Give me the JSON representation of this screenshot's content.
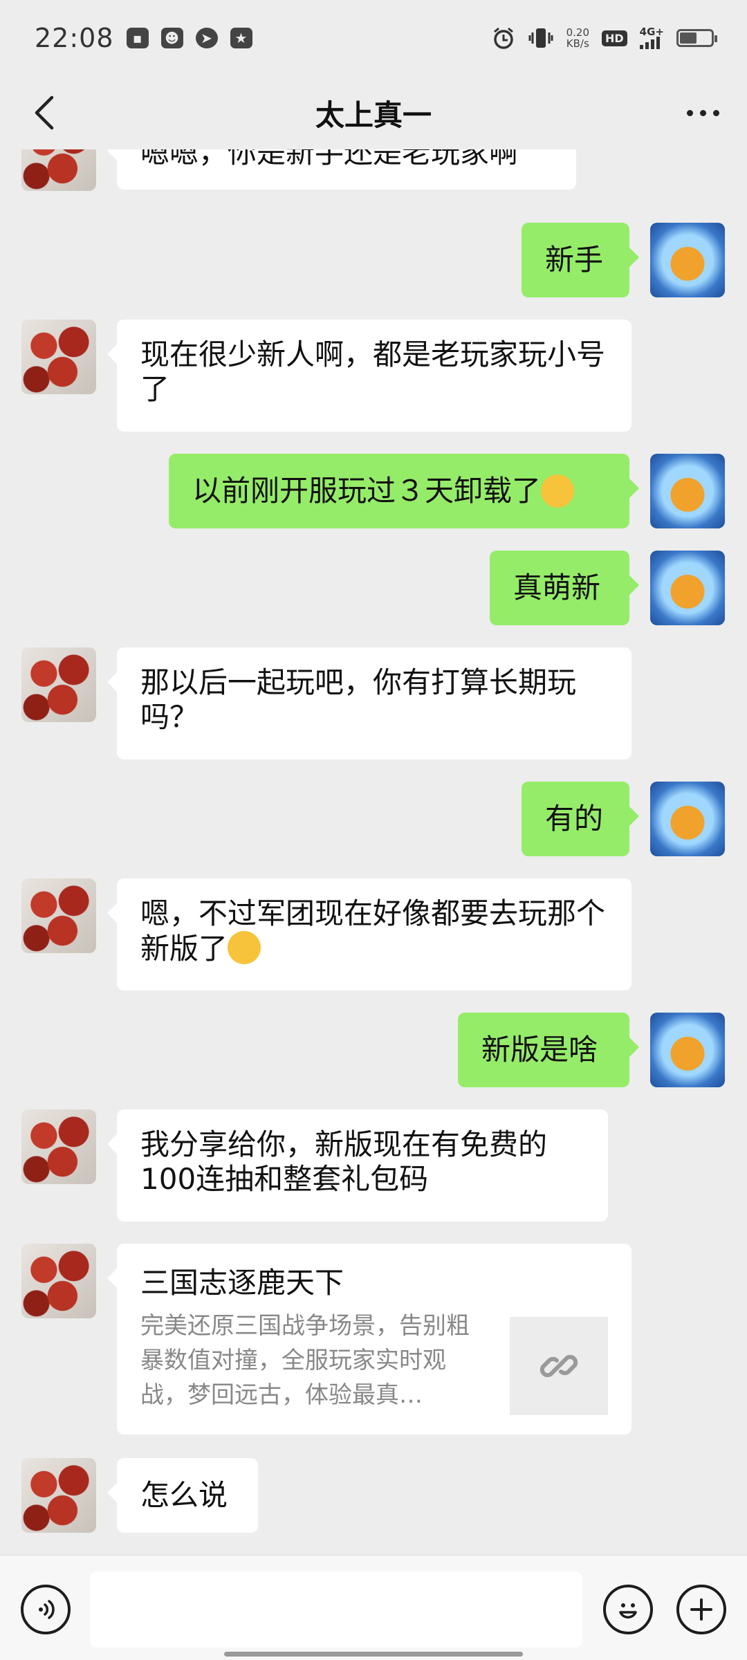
{
  "status_bar": {
    "time": "22:08",
    "net_speed_value": "0.20",
    "net_speed_unit": "KB/s",
    "hd_label": "HD",
    "network": "4G+",
    "battery_level": 0.55
  },
  "header": {
    "title": "太上真一"
  },
  "messages": [
    {
      "side": "in",
      "text": "嗯嗯，你是新手还是老玩家啊"
    },
    {
      "side": "out",
      "text": "新手"
    },
    {
      "side": "in",
      "text": "现在很少新人啊，都是老玩家玩小号了"
    },
    {
      "side": "out",
      "text": "以前刚开服玩过３天卸载了"
    },
    {
      "side": "out",
      "text": "真萌新"
    },
    {
      "side": "in",
      "text": "那以后一起玩吧，你有打算长期玩吗？"
    },
    {
      "side": "out",
      "text": "有的"
    },
    {
      "side": "in",
      "text": "嗯，不过军团现在好像都要去玩那个新版了"
    },
    {
      "side": "out",
      "text": "新版是啥"
    },
    {
      "side": "in",
      "text": "我分享给你，新版现在有免费的100连抽和整套礼包码"
    },
    {
      "side": "in",
      "text": "怎么说"
    }
  ],
  "link_card": {
    "title": "三国志逐鹿天下",
    "description": "完美还原三国战争场景，告别粗暴数值对撞，全服玩家实时观战，梦回远古，体验最真…"
  },
  "input_bar": {
    "placeholder": ""
  },
  "icons": {
    "back": "chevron-left-icon",
    "more": "more-dots-icon",
    "voice": "voice-icon",
    "emoji": "emoji-icon",
    "plus": "plus-icon",
    "link": "link-icon"
  },
  "colors": {
    "background": "#ededed",
    "outgoing_bubble": "#95ec69",
    "incoming_bubble": "#ffffff"
  }
}
